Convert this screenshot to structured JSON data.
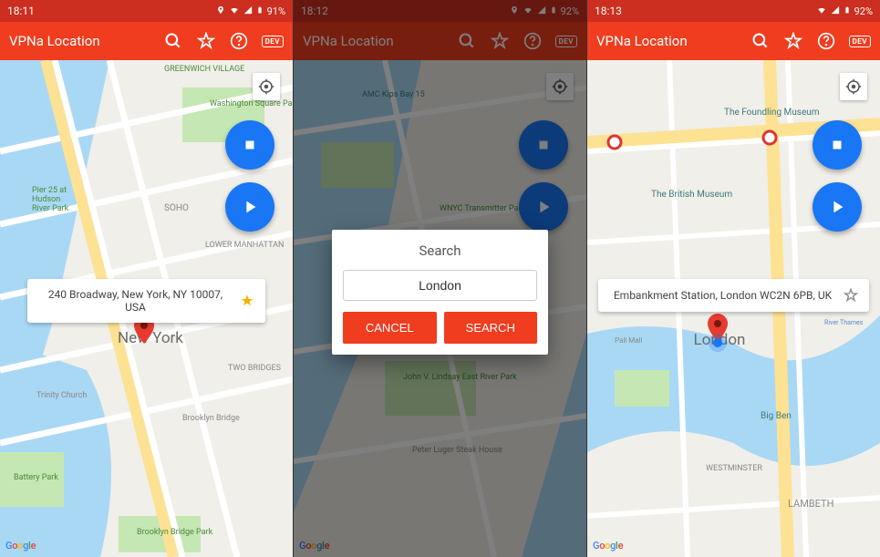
{
  "screens": [
    {
      "status": {
        "time": "18:11",
        "battery": "91%"
      },
      "app_title": "VPNa Location",
      "dev_label": "DEV",
      "callout": {
        "address": "240 Broadway, New York, NY 10007, USA",
        "starred": true
      },
      "city_label": "New York",
      "google": "Google"
    },
    {
      "status": {
        "time": "18:12",
        "battery": "92%"
      },
      "app_title": "VPNa Location",
      "dev_label": "DEV",
      "dialog": {
        "title": "Search",
        "value": "London",
        "cancel": "CANCEL",
        "search": "SEARCH"
      },
      "google": "Google"
    },
    {
      "status": {
        "time": "18:13",
        "battery": "92%"
      },
      "app_title": "VPNa Location",
      "dev_label": "DEV",
      "callout": {
        "address": "Embankment Station, London WC2N 6PB, UK",
        "starred": false
      },
      "city_label": "London",
      "google": "Google"
    }
  ]
}
